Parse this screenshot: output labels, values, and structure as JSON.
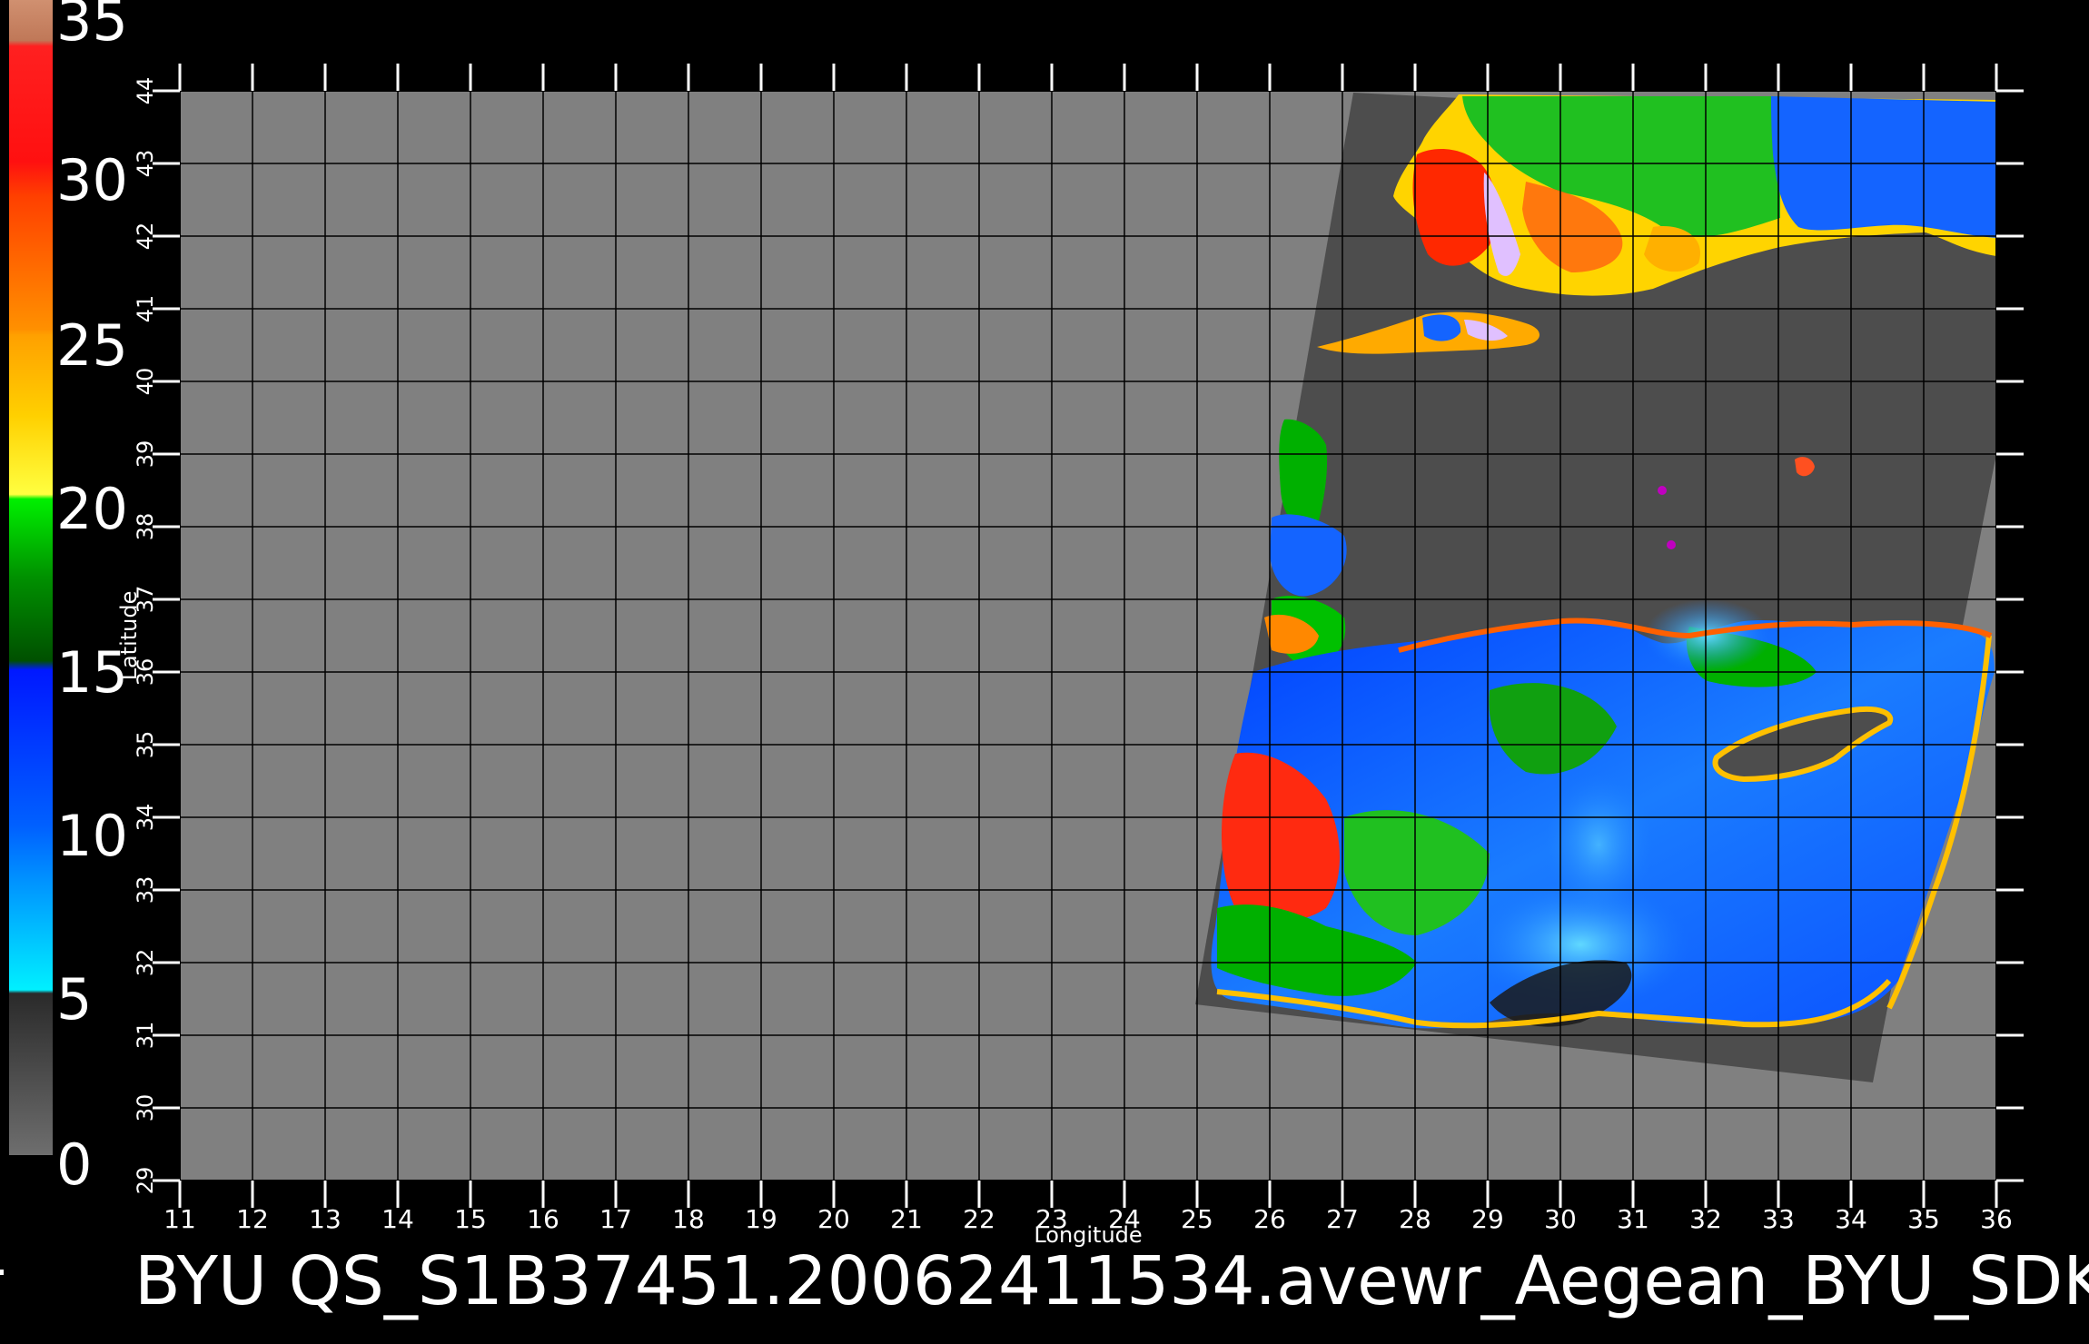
{
  "colorbar": {
    "labels": [
      "35",
      "30",
      "25",
      "20",
      "15",
      "10",
      "5",
      "0"
    ],
    "stops": [
      {
        "from": 0,
        "to": 5,
        "colors": [
          "#6a6a6a",
          "#2a2a2a"
        ]
      },
      {
        "from": 5,
        "to": 10,
        "colors": [
          "#00e8ff",
          "#0090ff"
        ]
      },
      {
        "from": 10,
        "to": 15,
        "colors": [
          "#0078ff",
          "#0020ff"
        ]
      },
      {
        "from": 15,
        "to": 20,
        "colors": [
          "#006000",
          "#00e000"
        ]
      },
      {
        "from": 20,
        "to": 25,
        "colors": [
          "#ffff30",
          "#ffb000"
        ]
      },
      {
        "from": 25,
        "to": 30,
        "colors": [
          "#ff8000",
          "#e03000"
        ]
      },
      {
        "from": 30,
        "to": 35,
        "colors": [
          "#ff1010",
          "#ff2020"
        ]
      },
      {
        "from": 35,
        "to": 36,
        "colors": [
          "#c07050",
          "#c08060"
        ]
      }
    ]
  },
  "map": {
    "xlabel": "Longitude",
    "ylabel": "Latitude",
    "lon_ticks": [
      "11",
      "12",
      "13",
      "14",
      "15",
      "16",
      "17",
      "18",
      "19",
      "20",
      "21",
      "22",
      "23",
      "24",
      "25",
      "26",
      "27",
      "28",
      "29",
      "30",
      "31",
      "32",
      "33",
      "34",
      "35",
      "36"
    ],
    "lat_ticks": [
      "29",
      "30",
      "31",
      "32",
      "33",
      "34",
      "35",
      "36",
      "37",
      "38",
      "39",
      "40",
      "41",
      "42",
      "43",
      "44"
    ],
    "lon_range": [
      11,
      36
    ],
    "lat_range": [
      29,
      44
    ],
    "background_color": "#808080",
    "swath_color": "#4d4d4d",
    "grid_color": "#000000"
  },
  "footer": {
    "title": "BYU  QS_S1B37451.20062411534.avewr_Aegean_BYU_SDK"
  }
}
